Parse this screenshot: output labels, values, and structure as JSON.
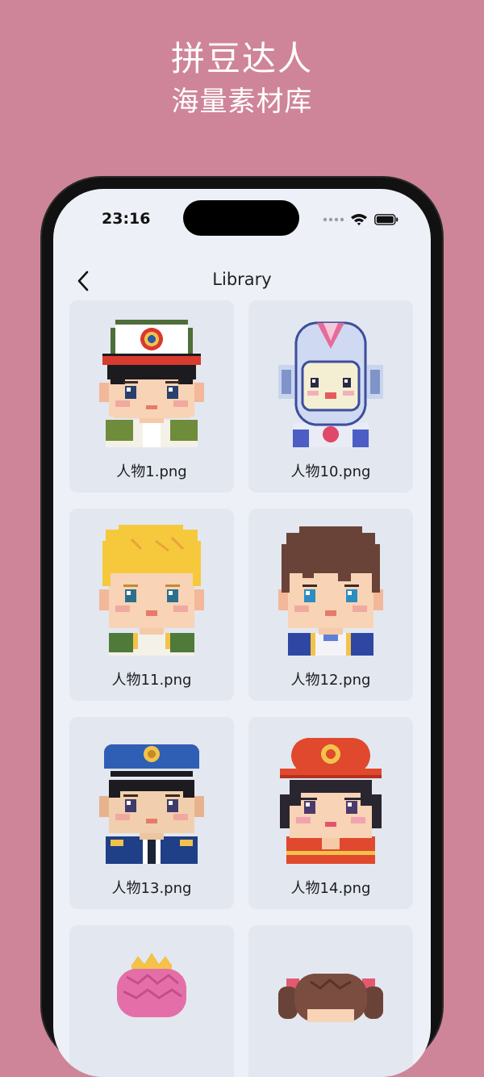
{
  "promo": {
    "title": "拼豆达人",
    "subtitle": "海量素材库"
  },
  "status_bar": {
    "time": "23:16",
    "icons": [
      "signal-dots-icon",
      "wifi-icon",
      "battery-icon"
    ]
  },
  "nav": {
    "back_icon": "chevron-left-icon",
    "title": "Library"
  },
  "library": {
    "items": [
      {
        "name": "人物1.png",
        "character": "cap boy"
      },
      {
        "name": "人物10.png",
        "character": "astronaut"
      },
      {
        "name": "人物11.png",
        "character": "blonde boy"
      },
      {
        "name": "人物12.png",
        "character": "brown hair boy"
      },
      {
        "name": "人物13.png",
        "character": "police officer"
      },
      {
        "name": "人物14.png",
        "character": "firefighter"
      },
      {
        "name": "",
        "character": "princess"
      },
      {
        "name": "",
        "character": "pigtail girl"
      }
    ]
  },
  "colors": {
    "background": "#cf8599",
    "screen": "#edf0f7",
    "card": "#e3e7f0"
  }
}
